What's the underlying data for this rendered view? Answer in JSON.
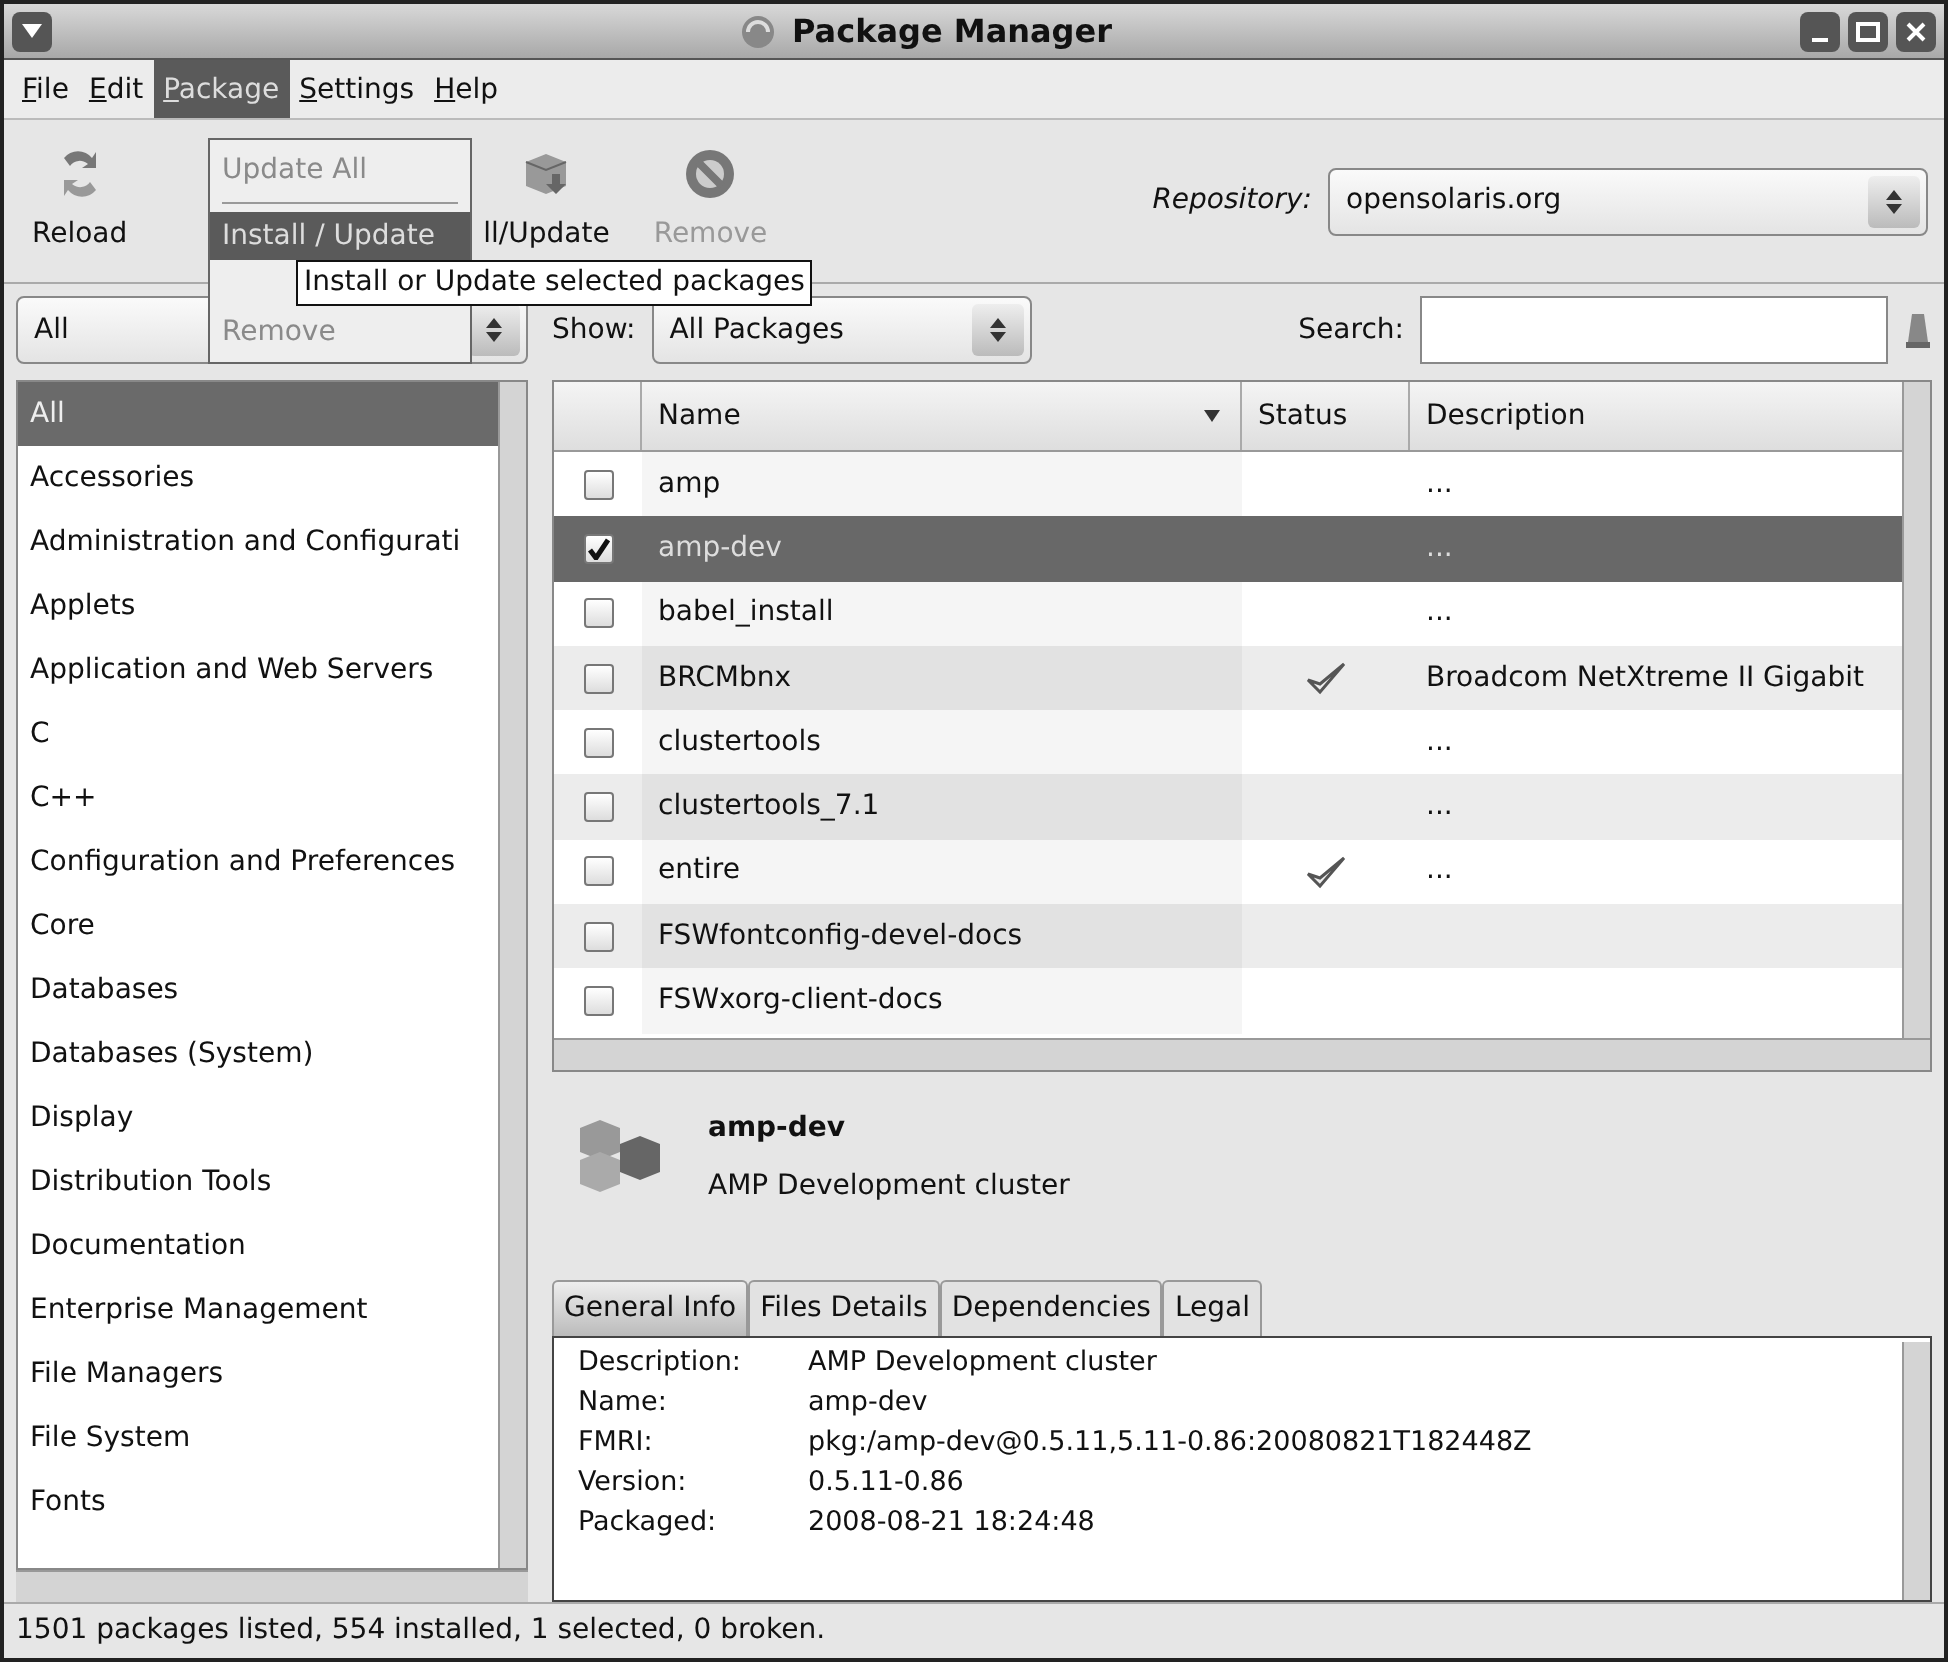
{
  "window": {
    "title": "Package Manager"
  },
  "menu": [
    {
      "label": "File",
      "selected": false
    },
    {
      "label": "Edit",
      "selected": false
    },
    {
      "label": "Package",
      "selected": true
    },
    {
      "label": "Settings",
      "selected": false
    },
    {
      "label": "Help",
      "selected": false
    }
  ],
  "package_menu": [
    {
      "kind": "item",
      "label": "Update All",
      "disabled": true,
      "selected": false
    },
    {
      "kind": "separator"
    },
    {
      "kind": "item",
      "label": "Install / Update",
      "disabled": false,
      "selected": true
    },
    {
      "kind": "item",
      "label": "Remove",
      "disabled": true,
      "selected": false
    }
  ],
  "tooltip": "Install or Update selected packages",
  "toolbar": [
    {
      "kind": "reload",
      "label": "Reload",
      "disabled": false
    },
    {
      "kind": "install",
      "label": "ll/Update",
      "disabled": false
    },
    {
      "kind": "remove",
      "label": "Remove",
      "disabled": true
    }
  ],
  "repository": {
    "label": "Repository:",
    "value": "opensolaris.org"
  },
  "category_filter": "All",
  "categories": [
    {
      "label": "All",
      "selected": true
    },
    {
      "label": "Accessories",
      "selected": false
    },
    {
      "label": "Administration and Configurati",
      "selected": false
    },
    {
      "label": "Applets",
      "selected": false
    },
    {
      "label": "Application and Web Servers",
      "selected": false
    },
    {
      "label": "C",
      "selected": false
    },
    {
      "label": "C++",
      "selected": false
    },
    {
      "label": "Configuration and Preferences",
      "selected": false
    },
    {
      "label": "Core",
      "selected": false
    },
    {
      "label": "Databases",
      "selected": false
    },
    {
      "label": "Databases (System)",
      "selected": false
    },
    {
      "label": "Display",
      "selected": false
    },
    {
      "label": "Distribution Tools",
      "selected": false
    },
    {
      "label": "Documentation",
      "selected": false
    },
    {
      "label": "Enterprise Management",
      "selected": false
    },
    {
      "label": "File Managers",
      "selected": false
    },
    {
      "label": "File System",
      "selected": false
    },
    {
      "label": "Fonts",
      "selected": false
    }
  ],
  "show": {
    "label": "Show:",
    "value": "All Packages"
  },
  "search": {
    "label": "Search:"
  },
  "table": {
    "columns": [
      "Name",
      "Status",
      "Description"
    ],
    "rows": [
      {
        "name": "amp",
        "checked": false,
        "selected": false,
        "installed": false,
        "description": "..."
      },
      {
        "name": "amp-dev",
        "checked": true,
        "selected": true,
        "installed": false,
        "description": "..."
      },
      {
        "name": "babel_install",
        "checked": false,
        "selected": false,
        "installed": false,
        "description": "..."
      },
      {
        "name": "BRCMbnx",
        "checked": false,
        "selected": false,
        "installed": true,
        "description": "Broadcom NetXtreme II Gigabit"
      },
      {
        "name": "clustertools",
        "checked": false,
        "selected": false,
        "installed": false,
        "description": "..."
      },
      {
        "name": "clustertools_7.1",
        "checked": false,
        "selected": false,
        "installed": false,
        "description": "..."
      },
      {
        "name": "entire",
        "checked": false,
        "selected": false,
        "installed": true,
        "description": "..."
      },
      {
        "name": "FSWfontconfig-devel-docs",
        "checked": false,
        "selected": false,
        "installed": false
      },
      {
        "name": "FSWxorg-client-docs",
        "checked": false,
        "selected": false,
        "installed": false
      }
    ]
  },
  "details": {
    "name": "amp-dev",
    "summary": "AMP Development cluster"
  },
  "detail_tabs": [
    {
      "label": "General Info",
      "selected": true
    },
    {
      "label": "Files Details",
      "selected": false
    },
    {
      "label": "Dependencies",
      "selected": false
    },
    {
      "label": "Legal",
      "selected": false
    }
  ],
  "info": [
    {
      "label": "Description:",
      "value": "AMP Development cluster"
    },
    {
      "label": "Name:",
      "value": "amp-dev"
    },
    {
      "label": "FMRI:",
      "value": "pkg:/amp-dev@0.5.11,5.11-0.86:20080821T182448Z"
    },
    {
      "label": "Version:",
      "value": "0.5.11-0.86"
    },
    {
      "label": "Packaged:",
      "value": "2008-08-21 18:24:48"
    }
  ],
  "status_bar": "1501 packages listed, 554 installed, 1 selected, 0 broken."
}
